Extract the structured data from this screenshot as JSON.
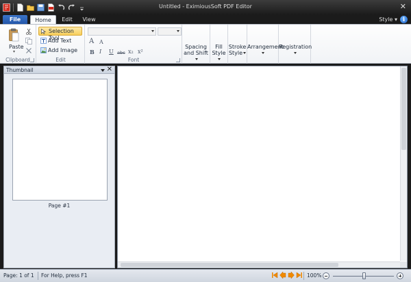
{
  "app": {
    "title": "Untitled - EximiousSoft PDF Editor"
  },
  "quick_access": [
    "app-icon",
    "new-icon",
    "open-icon",
    "save-icon",
    "pdf-icon",
    "undo-icon",
    "redo-icon",
    "customize-icon"
  ],
  "window": {
    "close_label": "✕"
  },
  "tabs": {
    "file": "File",
    "home": "Home",
    "edit": "Edit",
    "view": "View",
    "active": "Home"
  },
  "style_menu": {
    "label": "Style",
    "arrow": "▾"
  },
  "help": {
    "label": "i"
  },
  "ribbon": {
    "clipboard": {
      "label": "Clipboard",
      "paste": "Paste",
      "paste_arrow": "▾"
    },
    "edit": {
      "label": "Edit",
      "selection_tool": "Selection Tool",
      "add_text": "Add Text",
      "add_image": "Add Image"
    },
    "font": {
      "label": "Font",
      "font_name_value": "",
      "font_size_value": "",
      "grow": "A",
      "shrink": "A",
      "bold": "B",
      "italic": "I",
      "underline": "U",
      "strikethrough": "abc",
      "subscript": "x₂",
      "superscript": "x²"
    },
    "spacing": {
      "line1": "Spacing",
      "line2": "and Shift"
    },
    "fill": {
      "line1": "Fill",
      "line2": "Style"
    },
    "stroke": {
      "line1": "Stroke",
      "line2": "Style"
    },
    "arrangement": {
      "line1": "Arrangement"
    },
    "registration": {
      "line1": "Registration"
    }
  },
  "thumbnail": {
    "title": "Thumbnail",
    "close": "✕",
    "page_label": "Page #1"
  },
  "statusbar": {
    "page": "Page: 1 of 1",
    "help": "For Help, press F1",
    "zoom": "100%",
    "zoom_fraction": 0.5
  },
  "colors": {
    "accent": "#2356a9",
    "nav_arrows": "#f08a00",
    "selection": "#f8cf5c"
  }
}
